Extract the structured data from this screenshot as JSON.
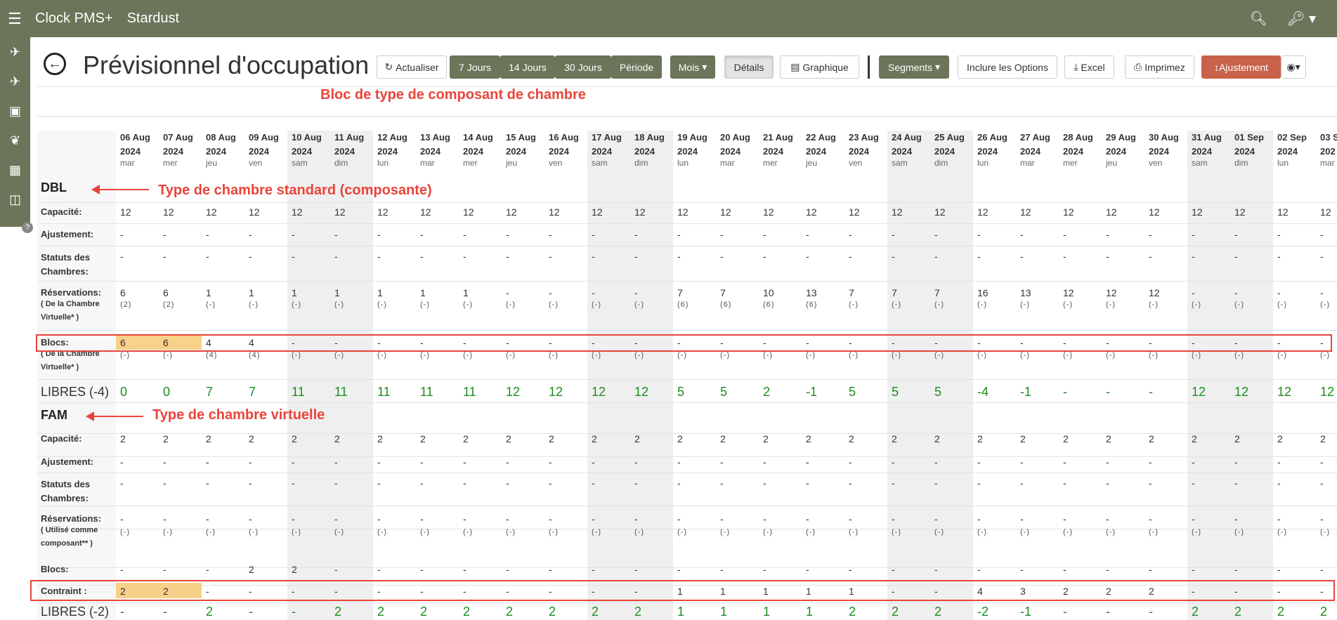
{
  "app": {
    "brand": "Clock PMS+",
    "hotel": "Stardust"
  },
  "header": {
    "title": "Prévisionnel d'occupation"
  },
  "toolbar": {
    "refresh": "Actualiser",
    "d7": "7 Jours",
    "d14": "14 Jours",
    "d30": "30 Jours",
    "period": "Période",
    "month": "Mois",
    "details": "Détails",
    "graph": "Graphique",
    "segments": "Segments",
    "include": "Inclure les Options",
    "excel": "Excel",
    "print": "Imprimez",
    "adjust": "Ajustement"
  },
  "annotations": {
    "block": "Bloc de type de composant de chambre",
    "std": "Type de chambre standard (composante)",
    "virt": "Type de chambre virtuelle"
  },
  "dates": [
    {
      "d": "06 Aug",
      "y": "2024",
      "w": "mar"
    },
    {
      "d": "07 Aug",
      "y": "2024",
      "w": "mer"
    },
    {
      "d": "08 Aug",
      "y": "2024",
      "w": "jeu"
    },
    {
      "d": "09 Aug",
      "y": "2024",
      "w": "ven"
    },
    {
      "d": "10 Aug",
      "y": "2024",
      "w": "sam"
    },
    {
      "d": "11 Aug",
      "y": "2024",
      "w": "dim"
    },
    {
      "d": "12 Aug",
      "y": "2024",
      "w": "lun"
    },
    {
      "d": "13 Aug",
      "y": "2024",
      "w": "mar"
    },
    {
      "d": "14 Aug",
      "y": "2024",
      "w": "mer"
    },
    {
      "d": "15 Aug",
      "y": "2024",
      "w": "jeu"
    },
    {
      "d": "16 Aug",
      "y": "2024",
      "w": "ven"
    },
    {
      "d": "17 Aug",
      "y": "2024",
      "w": "sam"
    },
    {
      "d": "18 Aug",
      "y": "2024",
      "w": "dim"
    },
    {
      "d": "19 Aug",
      "y": "2024",
      "w": "lun"
    },
    {
      "d": "20 Aug",
      "y": "2024",
      "w": "mar"
    },
    {
      "d": "21 Aug",
      "y": "2024",
      "w": "mer"
    },
    {
      "d": "22 Aug",
      "y": "2024",
      "w": "jeu"
    },
    {
      "d": "23 Aug",
      "y": "2024",
      "w": "ven"
    },
    {
      "d": "24 Aug",
      "y": "2024",
      "w": "sam"
    },
    {
      "d": "25 Aug",
      "y": "2024",
      "w": "dim"
    },
    {
      "d": "26 Aug",
      "y": "2024",
      "w": "lun"
    },
    {
      "d": "27 Aug",
      "y": "2024",
      "w": "mar"
    },
    {
      "d": "28 Aug",
      "y": "2024",
      "w": "mer"
    },
    {
      "d": "29 Aug",
      "y": "2024",
      "w": "jeu"
    },
    {
      "d": "30 Aug",
      "y": "2024",
      "w": "ven"
    },
    {
      "d": "31 Aug",
      "y": "2024",
      "w": "sam"
    },
    {
      "d": "01 Sep",
      "y": "2024",
      "w": "dim"
    },
    {
      "d": "02 Sep",
      "y": "2024",
      "w": "lun"
    },
    {
      "d": "03 S",
      "y": "202",
      "w": "mar"
    }
  ],
  "dbl": {
    "name": "DBL",
    "labels": {
      "capacity": "Capacité:",
      "adjust": "Ajustement:",
      "status1": "Statuts des",
      "status2": "Chambres:",
      "res": "Réservations:",
      "res_sub1": "( De la Chambre",
      "res_sub2": "Virtuelle* )",
      "blocks": "Blocs:",
      "blk_sub1": "( De la Chambre",
      "blk_sub2": "Virtuelle* )",
      "free": "LIBRES (-4)"
    },
    "capacity": [
      "12",
      "12",
      "12",
      "12",
      "12",
      "12",
      "12",
      "12",
      "12",
      "12",
      "12",
      "12",
      "12",
      "12",
      "12",
      "12",
      "12",
      "12",
      "12",
      "12",
      "12",
      "12",
      "12",
      "12",
      "12",
      "12",
      "12",
      "12",
      "12"
    ],
    "adjust": [
      "-",
      "-",
      "-",
      "-",
      "-",
      "-",
      "-",
      "-",
      "-",
      "-",
      "-",
      "-",
      "-",
      "-",
      "-",
      "-",
      "-",
      "-",
      "-",
      "-",
      "-",
      "-",
      "-",
      "-",
      "-",
      "-",
      "-",
      "-",
      "-"
    ],
    "status": [
      "-",
      "-",
      "-",
      "-",
      "-",
      "-",
      "-",
      "-",
      "-",
      "-",
      "-",
      "-",
      "-",
      "-",
      "-",
      "-",
      "-",
      "-",
      "-",
      "-",
      "-",
      "-",
      "-",
      "-",
      "-",
      "-",
      "-",
      "-",
      "-"
    ],
    "res": [
      "6",
      "6",
      "1",
      "1",
      "1",
      "1",
      "1",
      "1",
      "1",
      "-",
      "-",
      "-",
      "-",
      "7",
      "7",
      "10",
      "13",
      "7",
      "7",
      "7",
      "16",
      "13",
      "12",
      "12",
      "12",
      "-",
      "-",
      "-",
      "-"
    ],
    "res_sub": [
      "(2)",
      "(2)",
      "(-)",
      "(-)",
      "(-)",
      "(-)",
      "(-)",
      "(-)",
      "(-)",
      "(-)",
      "(-)",
      "(-)",
      "(-)",
      "(6)",
      "(6)",
      "(6)",
      "(6)",
      "(-)",
      "(-)",
      "(-)",
      "(-)",
      "(-)",
      "(-)",
      "(-)",
      "(-)",
      "(-)",
      "(-)",
      "(-)",
      "(-)"
    ],
    "blocks": [
      "6",
      "6",
      "4",
      "4",
      "-",
      "-",
      "-",
      "-",
      "-",
      "-",
      "-",
      "-",
      "-",
      "-",
      "-",
      "-",
      "-",
      "-",
      "-",
      "-",
      "-",
      "-",
      "-",
      "-",
      "-",
      "-",
      "-",
      "-",
      "-"
    ],
    "blk_sub": [
      "(-)",
      "(-)",
      "(4)",
      "(4)",
      "(-)",
      "(-)",
      "(-)",
      "(-)",
      "(-)",
      "(-)",
      "(-)",
      "(-)",
      "(-)",
      "(-)",
      "(-)",
      "(-)",
      "(-)",
      "(-)",
      "(-)",
      "(-)",
      "(-)",
      "(-)",
      "(-)",
      "(-)",
      "(-)",
      "(-)",
      "(-)",
      "(-)",
      "(-)"
    ],
    "free": [
      "0",
      "0",
      "7",
      "7",
      "11",
      "11",
      "11",
      "11",
      "11",
      "12",
      "12",
      "12",
      "12",
      "5",
      "5",
      "2",
      "-1",
      "5",
      "5",
      "5",
      "-4",
      "-1",
      "-",
      "-",
      "-",
      "12",
      "12",
      "12",
      "12"
    ]
  },
  "fam": {
    "name": "FAM",
    "labels": {
      "capacity": "Capacité:",
      "adjust": "Ajustement:",
      "status1": "Statuts des",
      "status2": "Chambres:",
      "res": "Réservations:",
      "res_sub1": "( Utilisé comme",
      "res_sub2": "composant** )",
      "blocks": "Blocs:",
      "constraint": "Contraint :",
      "free": "LIBRES (-2)"
    },
    "capacity": [
      "2",
      "2",
      "2",
      "2",
      "2",
      "2",
      "2",
      "2",
      "2",
      "2",
      "2",
      "2",
      "2",
      "2",
      "2",
      "2",
      "2",
      "2",
      "2",
      "2",
      "2",
      "2",
      "2",
      "2",
      "2",
      "2",
      "2",
      "2",
      "2"
    ],
    "adjust": [
      "-",
      "-",
      "-",
      "-",
      "-",
      "-",
      "-",
      "-",
      "-",
      "-",
      "-",
      "-",
      "-",
      "-",
      "-",
      "-",
      "-",
      "-",
      "-",
      "-",
      "-",
      "-",
      "-",
      "-",
      "-",
      "-",
      "-",
      "-",
      "-"
    ],
    "status": [
      "-",
      "-",
      "-",
      "-",
      "-",
      "-",
      "-",
      "-",
      "-",
      "-",
      "-",
      "-",
      "-",
      "-",
      "-",
      "-",
      "-",
      "-",
      "-",
      "-",
      "-",
      "-",
      "-",
      "-",
      "-",
      "-",
      "-",
      "-",
      "-"
    ],
    "res": [
      "-",
      "-",
      "-",
      "-",
      "-",
      "-",
      "-",
      "-",
      "-",
      "-",
      "-",
      "-",
      "-",
      "-",
      "-",
      "-",
      "-",
      "-",
      "-",
      "-",
      "-",
      "-",
      "-",
      "-",
      "-",
      "-",
      "-",
      "-",
      "-"
    ],
    "res_sub": [
      "(-)",
      "(-)",
      "(-)",
      "(-)",
      "(-)",
      "(-)",
      "(-)",
      "(-)",
      "(-)",
      "(-)",
      "(-)",
      "(-)",
      "(-)",
      "(-)",
      "(-)",
      "(-)",
      "(-)",
      "(-)",
      "(-)",
      "(-)",
      "(-)",
      "(-)",
      "(-)",
      "(-)",
      "(-)",
      "(-)",
      "(-)",
      "(-)",
      "(-)"
    ],
    "blocks": [
      "-",
      "-",
      "-",
      "2",
      "2",
      "-",
      "-",
      "-",
      "-",
      "-",
      "-",
      "-",
      "-",
      "-",
      "-",
      "-",
      "-",
      "-",
      "-",
      "-",
      "-",
      "-",
      "-",
      "-",
      "-",
      "-",
      "-",
      "-",
      "-"
    ],
    "constraint": [
      "2",
      "2",
      "-",
      "-",
      "-",
      "-",
      "-",
      "-",
      "-",
      "-",
      "-",
      "-",
      "-",
      "1",
      "1",
      "1",
      "1",
      "1",
      "-",
      "-",
      "4",
      "3",
      "2",
      "2",
      "2",
      "-",
      "-",
      "-",
      "-"
    ],
    "free": [
      "-",
      "-",
      "2",
      "-",
      "-",
      "2",
      "2",
      "2",
      "2",
      "2",
      "2",
      "2",
      "2",
      "1",
      "1",
      "1",
      "1",
      "2",
      "2",
      "2",
      "-2",
      "-1",
      "-",
      "-",
      "-",
      "2",
      "2",
      "2",
      "2"
    ]
  }
}
